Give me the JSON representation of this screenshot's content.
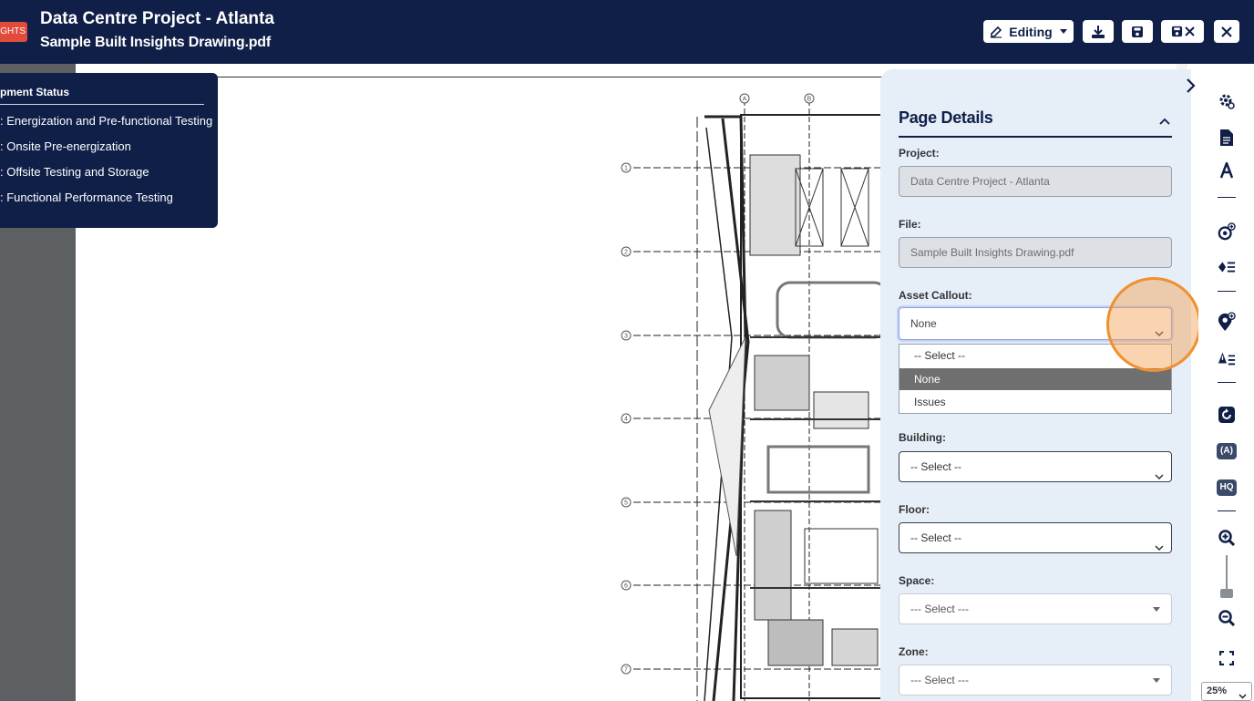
{
  "header": {
    "badge": "GHTS",
    "title": "Data Centre Project - Atlanta",
    "file_name": "Sample Built Insights Drawing.pdf",
    "mode_label": "Editing"
  },
  "legend": {
    "title": "pment Status",
    "items": [
      ": Energization and Pre-functional Testing",
      ": Onsite Pre-energization",
      ": Offsite Testing and Storage",
      ": Functional Performance Testing"
    ]
  },
  "drawing": {
    "column_markers": [
      "A",
      "B"
    ],
    "row_markers": [
      "1",
      "2",
      "3",
      "4",
      "5",
      "6",
      "7"
    ]
  },
  "panel": {
    "title": "Page Details",
    "project_label": "Project:",
    "project_value": "Data Centre Project - Atlanta",
    "file_label": "File:",
    "file_value": "Sample Built Insights Drawing.pdf",
    "asset_label": "Asset Callout:",
    "asset_value": "None",
    "asset_options": [
      "-- Select --",
      "None",
      "Issues"
    ],
    "building_label": "Building:",
    "building_value": "-- Select --",
    "floor_label": "Floor:",
    "floor_value": "-- Select --",
    "space_label": "Space:",
    "space_value": "--- Select ---",
    "zone_label": "Zone:",
    "zone_value": "--- Select ---"
  },
  "toolbar": {
    "badge_a": "(A)",
    "badge_hq": "HQ",
    "zoom_value": "25%"
  },
  "colors": {
    "navy": "#0f1f48",
    "accent_red": "#e04b3c",
    "highlight_orange": "#f0902e",
    "panel_bg": "#e6eef8"
  }
}
